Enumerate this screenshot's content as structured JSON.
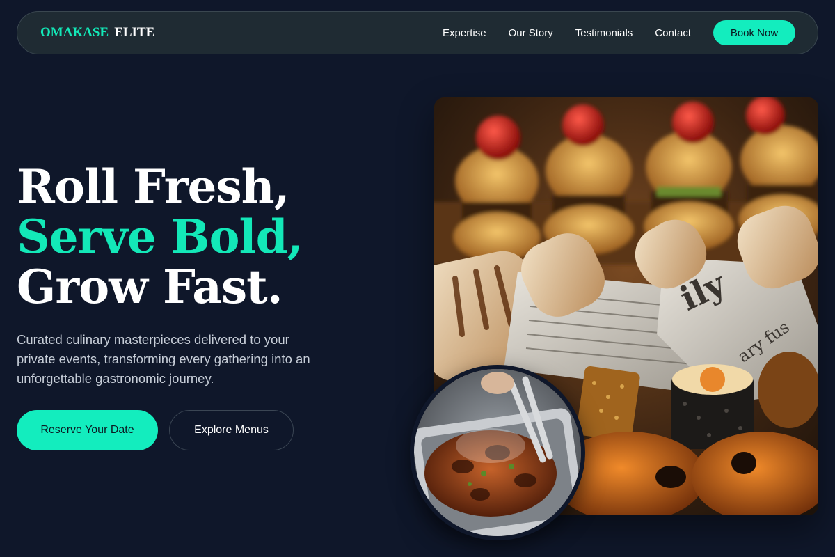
{
  "nav": {
    "logo_accent": "OMAKASE",
    "logo_plain": "ELITE",
    "links": [
      "Expertise",
      "Our Story",
      "Testimonials",
      "Contact"
    ],
    "cta": "Book Now"
  },
  "hero": {
    "title_line1": "Roll Fresh,",
    "title_line2": "Serve Bold,",
    "title_line3": "Grow Fast.",
    "subtitle": "Curated culinary masterpieces delivered to your private events, transforming every gathering into an unforgettable gastronomic journey.",
    "primary_button": "Reserve Your Date",
    "secondary_button": "Explore Menus"
  },
  "colors": {
    "background": "#0f172a",
    "accent": "#13e8b8",
    "nav_bg": "#1f2b33"
  },
  "images": {
    "main": "food-platter-photo",
    "secondary": "grilled-meat-photo"
  }
}
